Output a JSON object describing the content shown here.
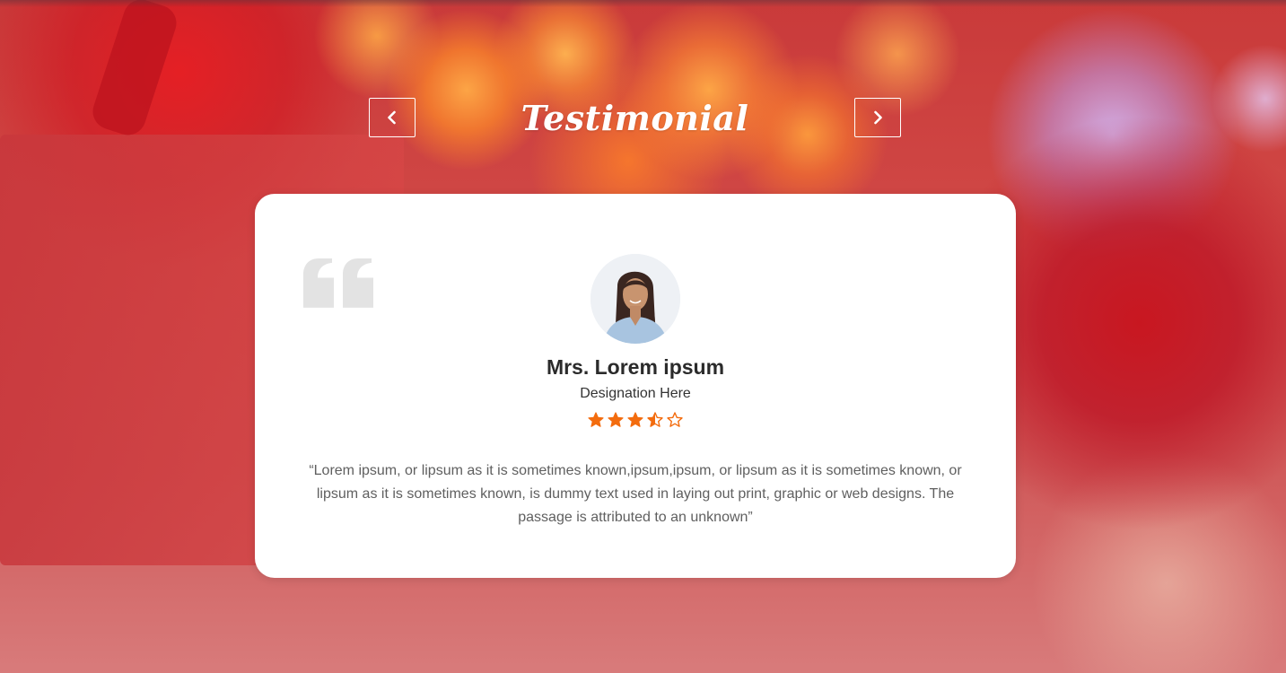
{
  "section": {
    "title": "Testimonial",
    "prev_button_icon": "chevron-left-icon",
    "next_button_icon": "chevron-right-icon"
  },
  "testimonial": {
    "quote_icon": "quote-icon",
    "name": "Mrs. Lorem ipsum",
    "designation": "Designation Here",
    "rating": 3.5,
    "rating_max": 5,
    "text": "“Lorem ipsum, or lipsum as it is sometimes known,ipsum,ipsum, or lipsum as it is sometimes known, or lipsum as it is sometimes known, is dummy text used in laying out print, graphic or web designs. The passage is attributed to an unknown”"
  },
  "colors": {
    "star": "#f36c0e",
    "quote_mark": "#e3e3e3",
    "title_text": "#ffffff",
    "card_background": "#ffffff"
  }
}
